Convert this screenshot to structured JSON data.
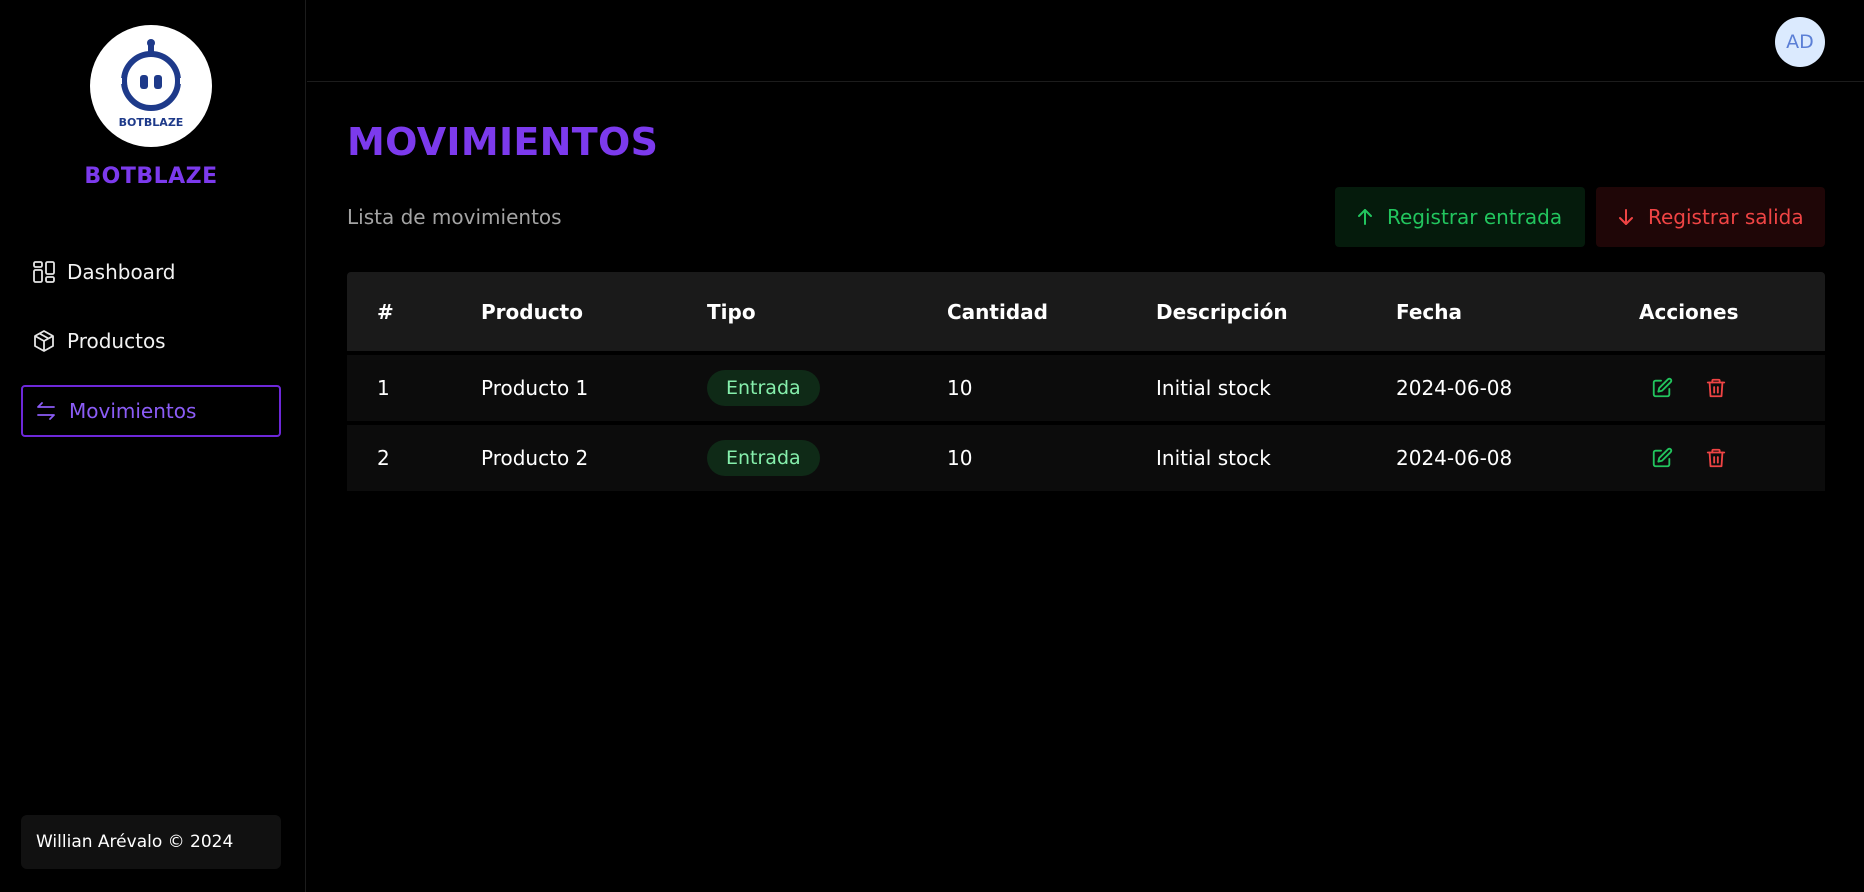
{
  "brand": {
    "name": "BOTBLAZE",
    "logo_text": "BOTBLAZE"
  },
  "sidebar": {
    "items": [
      {
        "label": "Dashboard",
        "icon": "dashboard-grid-icon",
        "active": false
      },
      {
        "label": "Productos",
        "icon": "box-icon",
        "active": false
      },
      {
        "label": "Movimientos",
        "icon": "swap-arrows-icon",
        "active": true
      }
    ],
    "footer": "Willian Arévalo © 2024"
  },
  "topbar": {
    "avatar_initials": "AD"
  },
  "main": {
    "title": "MOVIMIENTOS",
    "subtitle": "Lista de movimientos",
    "buttons": {
      "register_in": "Registrar entrada",
      "register_out": "Registrar salida"
    },
    "table": {
      "headers": [
        "#",
        "Producto",
        "Tipo",
        "Cantidad",
        "Descripción",
        "Fecha",
        "Acciones"
      ],
      "rows": [
        {
          "id": "1",
          "product": "Producto 1",
          "type": "Entrada",
          "quantity": "10",
          "description": "Initial stock",
          "date": "2024-06-08"
        },
        {
          "id": "2",
          "product": "Producto 2",
          "type": "Entrada",
          "quantity": "10",
          "description": "Initial stock",
          "date": "2024-06-08"
        }
      ]
    }
  },
  "colors": {
    "accent": "#7c3aed",
    "success": "#22c55e",
    "danger": "#ef4444",
    "background": "#000000"
  }
}
